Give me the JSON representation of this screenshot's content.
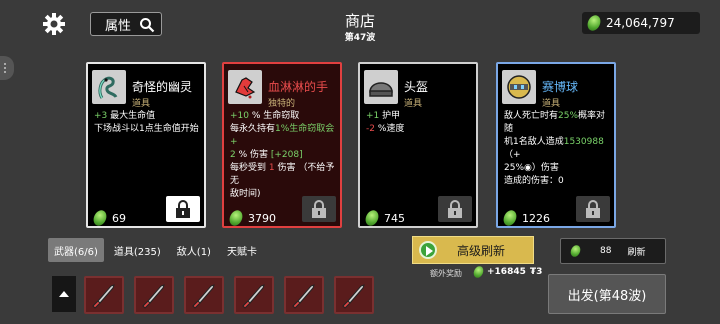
{
  "header": {
    "attr_label": "属性",
    "shop_title": "商店",
    "wave_label": "第47波",
    "money": "24,064,797"
  },
  "cards": [
    {
      "name": "奇怪的幽灵",
      "name_color": "#ffffff",
      "rarity": "道具",
      "lines": [
        {
          "parts": [
            {
              "t": "+3",
              "c": "pos"
            },
            {
              "t": " 最大生命值",
              "c": ""
            }
          ]
        },
        {
          "parts": [
            {
              "t": "下场战斗以1点生命值开始",
              "c": ""
            }
          ]
        }
      ],
      "price": "69",
      "lock_white": true,
      "icon": "ghost-icon"
    },
    {
      "name": "血淋淋的手",
      "name_color": "#e84c4c",
      "rarity": "独特的",
      "lines": [
        {
          "parts": [
            {
              "t": "+10",
              "c": "pos"
            },
            {
              "t": " % 生命窃取",
              "c": ""
            }
          ]
        },
        {
          "parts": [
            {
              "t": "每永久持有",
              "c": ""
            },
            {
              "t": "1%生命窃取会+",
              "c": "pos"
            }
          ]
        },
        {
          "parts": [
            {
              "t": "2",
              "c": "pos"
            },
            {
              "t": " % 伤害 ",
              "c": ""
            },
            {
              "t": "[+208]",
              "c": "pos"
            }
          ]
        },
        {
          "parts": [
            {
              "t": "每秒受到 ",
              "c": ""
            },
            {
              "t": "1",
              "c": "neg"
            },
            {
              "t": " 伤害 （不给予无",
              "c": ""
            }
          ]
        },
        {
          "parts": [
            {
              "t": "敌时间)",
              "c": ""
            }
          ]
        }
      ],
      "price": "3790",
      "lock_white": false,
      "icon": "bloody-hand-icon"
    },
    {
      "name": "头盔",
      "name_color": "#ffffff",
      "rarity": "道具",
      "lines": [
        {
          "parts": [
            {
              "t": "+1",
              "c": "pos"
            },
            {
              "t": " 护甲",
              "c": ""
            }
          ]
        },
        {
          "parts": [
            {
              "t": "-2",
              "c": "neg"
            },
            {
              "t": " %速度",
              "c": ""
            }
          ]
        }
      ],
      "price": "745",
      "lock_white": false,
      "icon": "helmet-icon"
    },
    {
      "name": "赛博球",
      "name_color": "#64b5f6",
      "rarity": "道具",
      "lines": [
        {
          "parts": [
            {
              "t": "敌人死亡时有",
              "c": ""
            },
            {
              "t": "25%",
              "c": "pos"
            },
            {
              "t": "概率对随",
              "c": ""
            }
          ]
        },
        {
          "parts": [
            {
              "t": "机1名敌人造成",
              "c": ""
            },
            {
              "t": "1530988",
              "c": "pos"
            },
            {
              "t": "（+",
              "c": ""
            }
          ]
        },
        {
          "parts": [
            {
              "t": "25%",
              "c": ""
            },
            {
              "t": "◉",
              "c": ""
            },
            {
              "t": "）伤害",
              "c": ""
            }
          ]
        },
        {
          "parts": [
            {
              "t": "造成的伤害：0",
              "c": ""
            }
          ]
        }
      ],
      "price": "1226",
      "lock_white": false,
      "icon": "cyber-ball-icon"
    }
  ],
  "tabs": [
    {
      "label": "武器(6/6)",
      "active": true
    },
    {
      "label": "道具(235)",
      "active": false
    },
    {
      "label": "敌人(1)",
      "active": false
    },
    {
      "label": "天赋卡",
      "active": false
    }
  ],
  "refresh": {
    "advanced_label": "高级刷新",
    "bonus_label": "额外奖励",
    "bonus_value": "+16845",
    "bonus_suffix": "₮3",
    "cost": "88",
    "refresh_label": "刷新"
  },
  "start_button": "出发(第48波)",
  "weapons": {
    "count": 6,
    "icon": "knife-icon"
  },
  "colors": {
    "background": "#3a3a3a",
    "gold": "#d9b94e",
    "positive": "#7bd36a",
    "negative": "#e84c4c",
    "rare": "#64b5f6"
  }
}
